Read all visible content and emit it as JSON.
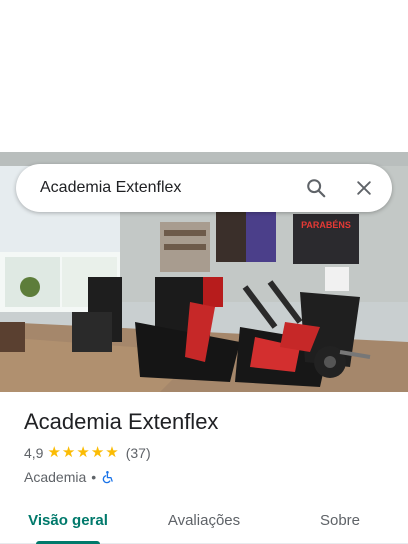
{
  "search": {
    "query": "Academia Extenflex",
    "search_icon": "search-icon",
    "close_icon": "close-icon"
  },
  "photo": {
    "poster_text": "PARABÉNS"
  },
  "place": {
    "name": "Academia Extenflex",
    "rating": "4,9",
    "stars": 5,
    "reviews": "(37)",
    "category": "Academia",
    "separator": "•",
    "accessibility_icon": "wheelchair-icon"
  },
  "tabs": [
    {
      "label": "Visão geral",
      "active": true
    },
    {
      "label": "Avaliações",
      "active": false
    },
    {
      "label": "Sobre",
      "active": false
    }
  ],
  "colors": {
    "accent": "#00796b",
    "star": "#fbbc04",
    "accessibility": "#1a73e8"
  }
}
